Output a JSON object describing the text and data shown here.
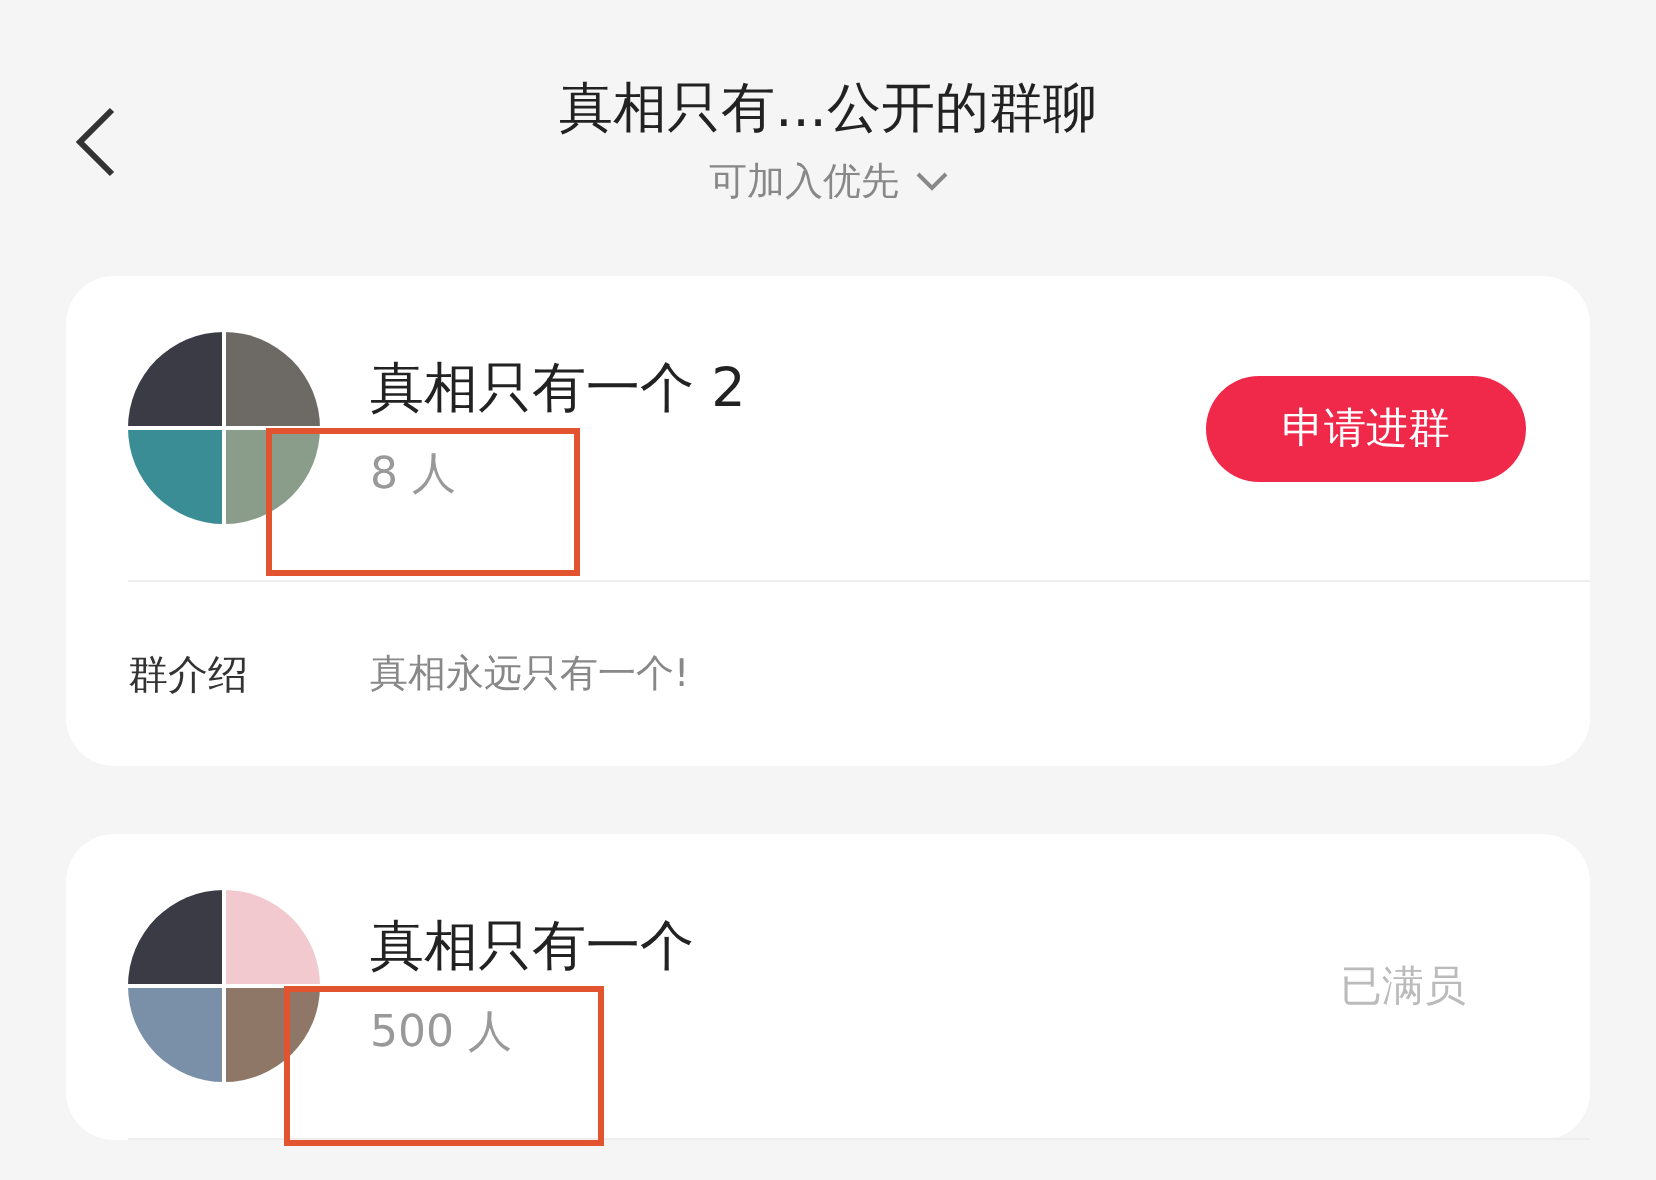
{
  "header": {
    "title": "真相只有...公开的群聊",
    "sort": "可加入优先"
  },
  "groups": [
    {
      "name": "真相只有一个 2",
      "members": "8 人",
      "highlighted": true,
      "action": {
        "kind": "button",
        "label": "申请进群"
      },
      "intro_label": "群介绍",
      "intro": "真相永远只有一个!"
    },
    {
      "name": "真相只有一个",
      "members": "500 人",
      "highlighted": true,
      "action": {
        "kind": "status",
        "label": "已满员"
      }
    }
  ]
}
